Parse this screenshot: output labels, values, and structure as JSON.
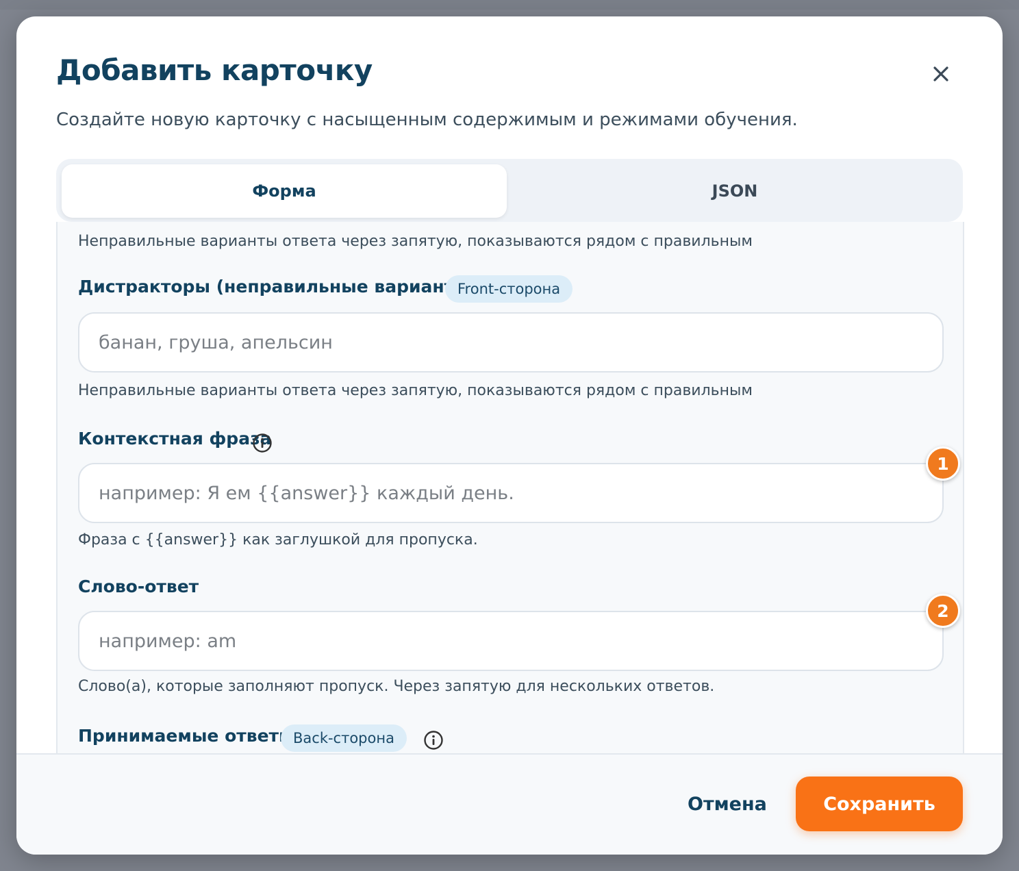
{
  "dialog": {
    "title": "Добавить карточку",
    "subtitle": "Создайте новую карточку с насыщенным содержимым и режимами обучения.",
    "close_icon": "close-icon"
  },
  "tabs": [
    {
      "label": "Форма",
      "active": true
    },
    {
      "label": "JSON",
      "active": false
    }
  ],
  "form": {
    "top_hint": "Неправильные варианты ответа через запятую, показываются рядом с правильным",
    "distractors": {
      "label": "Дистракторы (неправильные варианты)",
      "badge": "Front-сторона",
      "placeholder": "банан, груша, апельсин",
      "value": "",
      "hint": "Неправильные варианты ответа через запятую, показываются рядом с правильным"
    },
    "context_phrase": {
      "label": "Контекстная фраза",
      "info_icon": "info-icon",
      "placeholder": "например: Я ем {{answer}} каждый день.",
      "value": "",
      "hint": "Фраза с {{answer}} как заглушкой для пропуска.",
      "step": "1"
    },
    "answer_word": {
      "label": "Слово-ответ",
      "placeholder": "например: am",
      "value": "",
      "hint": "Слово(а), которые заполняют пропуск. Через запятую для нескольких ответов.",
      "step": "2"
    },
    "accepted_answers": {
      "label": "Принимаемые ответы",
      "badge": "Back-сторона",
      "info_icon": "info-icon"
    }
  },
  "footer": {
    "cancel_label": "Отмена",
    "save_label": "Сохранить"
  },
  "colors": {
    "primary_text": "#12425f",
    "accent": "#f97216",
    "badge_bg": "#dcedf8"
  }
}
